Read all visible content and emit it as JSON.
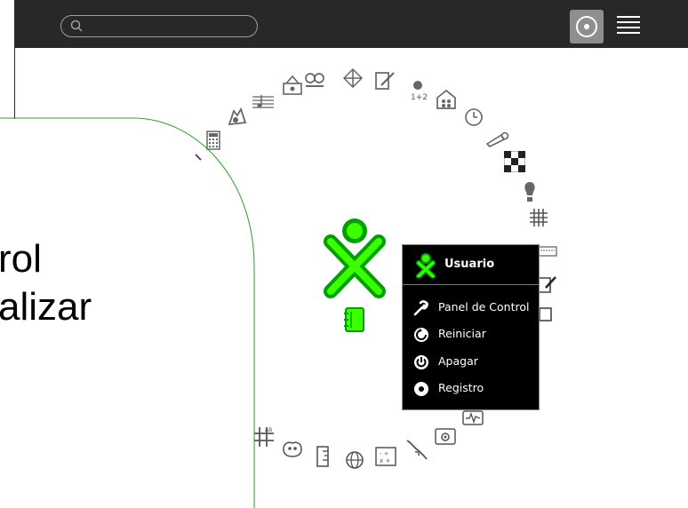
{
  "toolbar": {
    "search_placeholder": "",
    "home_view_icon": "home-view-icon",
    "list_view_icon": "list-view-icon"
  },
  "overlay": {
    "line1": "rol",
    "line2": "alizar"
  },
  "palette": {
    "title": "Usuario",
    "items": [
      {
        "label": "Panel de Control",
        "icon": "wrench-icon"
      },
      {
        "label": "Reiniciar",
        "icon": "restart-icon"
      },
      {
        "label": "Apagar",
        "icon": "power-icon"
      },
      {
        "label": "Registro",
        "icon": "logout-icon"
      }
    ]
  },
  "colors": {
    "toolbar_bg": "#282828",
    "xo_stroke": "#00a000",
    "xo_fill": "#3cff00",
    "palette_bg": "#000000",
    "curve": "#2e9d2e"
  }
}
